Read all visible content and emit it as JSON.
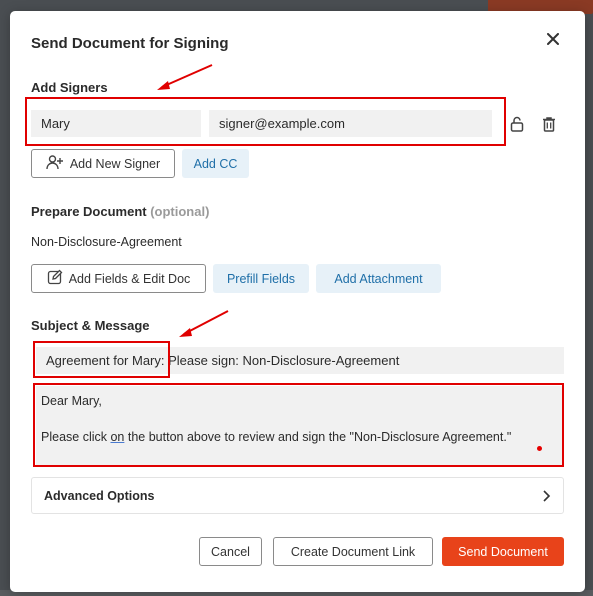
{
  "modal": {
    "title": "Send Document for Signing",
    "close_icon": "close-icon"
  },
  "signers": {
    "section_title": "Add Signers",
    "rows": [
      {
        "name": "Mary",
        "email": "signer@example.com"
      }
    ],
    "add_signer_label": "Add New Signer",
    "add_cc_label": "Add CC"
  },
  "prepare": {
    "section_title": "Prepare Document",
    "optional_label": "(optional)",
    "document_name": "Non-Disclosure-Agreement",
    "add_fields_label": "Add Fields & Edit Doc",
    "prefill_label": "Prefill Fields",
    "attachment_label": "Add Attachment"
  },
  "message": {
    "section_title": "Subject & Message",
    "subject": "Agreement for Mary: Please sign: Non-Disclosure-Agreement",
    "body_line1": "Dear Mary,",
    "body_line3_prefix": "Please click ",
    "body_line3_on": "on",
    "body_line3_suffix": " the button above to review and sign the \"Non-Disclosure Agreement.\""
  },
  "advanced": {
    "label": "Advanced Options"
  },
  "footer": {
    "cancel_label": "Cancel",
    "create_link_label": "Create Document Link",
    "send_label": "Send Document"
  },
  "colors": {
    "primary": "#e8431a",
    "link": "#1f6fa8",
    "annotation": "#e00000"
  }
}
